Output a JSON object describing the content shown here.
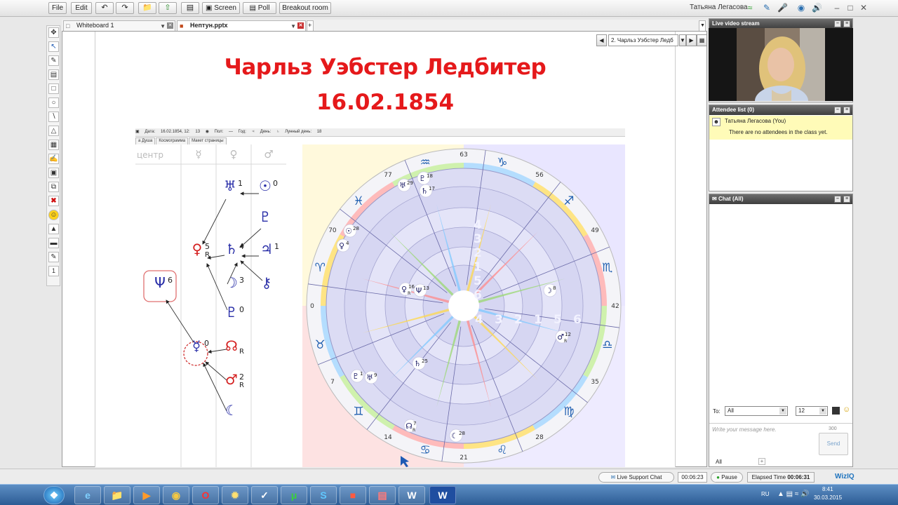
{
  "toolbar": {
    "file": "File",
    "edit": "Edit",
    "screen": "Screen",
    "poll": "Poll",
    "breakout": "Breakout room",
    "user_name": "Татьяна Легасова"
  },
  "tabs": [
    {
      "label": "Whiteboard 1"
    },
    {
      "label": "Нептун.pptx"
    },
    {
      "label": "+"
    }
  ],
  "tools": {
    "page_number": "1"
  },
  "slide": {
    "title": "Чарльз Уэбстер Ледбитер",
    "date": "16.02.1854",
    "selector": "2. Чарльз Уэбстер Ледб"
  },
  "astro_toolbar": {
    "date_label": "Дата:",
    "date_value": "16.02.1854, 12:",
    "date_num": "13",
    "pos_label": "Пол:",
    "pos_value": "—",
    "year_label": "Год:",
    "year_sym": "♃",
    "day_label": "День:",
    "day_sym": "♄",
    "lunar_label": "Лунный день:",
    "lunar_value": "18"
  },
  "astro_tabs": [
    "а Душа",
    "Космограмма",
    "Макет страницы"
  ],
  "diagram": {
    "col_label": "центр",
    "headers": [
      "☿",
      "♀",
      "♂"
    ],
    "nodes": [
      {
        "sym": "♅",
        "num": "1",
        "color": "#2a2fa8"
      },
      {
        "sym": "☉",
        "num": "0",
        "color": "#2a2fa8"
      },
      {
        "sym": "♇",
        "num": "",
        "color": "#2a2fa8"
      },
      {
        "sym": "♀",
        "num": "5",
        "r": "R",
        "color": "#d42020"
      },
      {
        "sym": "♄",
        "num": "4",
        "color": "#2a2fa8"
      },
      {
        "sym": "♃",
        "num": "1",
        "color": "#2a2fa8"
      },
      {
        "sym": "Ψ",
        "num": "6",
        "color": "#2a2fa8"
      },
      {
        "sym": "☽",
        "num": "3",
        "color": "#2a2fa8"
      },
      {
        "sym": "⚷",
        "num": "",
        "color": "#2a2fa8"
      },
      {
        "sym": "♇",
        "num": "0",
        "color": "#2a2fa8"
      },
      {
        "sym": "☿",
        "num": "0",
        "color": "#2a2fa8"
      },
      {
        "sym": "☊",
        "num": "",
        "r": "R",
        "color": "#d42020"
      },
      {
        "sym": "♂",
        "num": "2",
        "r": "R",
        "color": "#d42020"
      },
      {
        "sym": "☾",
        "num": "",
        "color": "#2a2fa8"
      }
    ]
  },
  "wheel": {
    "degree_labels": [
      "63",
      "56",
      "49",
      "42",
      "35",
      "28",
      "21",
      "14",
      "7",
      "0",
      "70",
      "77"
    ],
    "signs": [
      "♑",
      "♐",
      "♏",
      "♎",
      "♍",
      "♌",
      "♋",
      "♊",
      "♉",
      "♈",
      "♓",
      "♒"
    ],
    "planets": [
      {
        "sym": "♅",
        "num": "29"
      },
      {
        "sym": "♇",
        "num": "18"
      },
      {
        "sym": "♄",
        "num": "17"
      },
      {
        "sym": "☉",
        "num": "28"
      },
      {
        "sym": "♀",
        "num": "4"
      },
      {
        "sym": "♀",
        "num": "16",
        "r": "R"
      },
      {
        "sym": "Ψ",
        "num": "13"
      },
      {
        "sym": "☽",
        "num": "8"
      },
      {
        "sym": "♂",
        "num": "12",
        "r": "R"
      },
      {
        "sym": "♄",
        "num": "25"
      },
      {
        "sym": "♇",
        "num": "1"
      },
      {
        "sym": "♅",
        "num": "9"
      },
      {
        "sym": "☊",
        "num": "7",
        "r": "R"
      },
      {
        "sym": "☾",
        "num": "28"
      }
    ],
    "ring_numbers": [
      "4",
      "3",
      "2",
      "1",
      "5",
      "6"
    ]
  },
  "panels": {
    "video_title": "Live video stream",
    "attendee_title": "Attendee list (0)",
    "attendee_you": "Татьяна Легасова (You)",
    "attendee_empty": "There are no attendees in the class yet.",
    "chat_title": "Chat (All)",
    "to_label": "To:",
    "to_value": "All",
    "font_size": "12",
    "message_placeholder": "Write your message here.",
    "char_count": "300",
    "send": "Send",
    "scope": "All"
  },
  "status": {
    "support": "Live Support Chat",
    "timer": "00:06:23",
    "pause": "Pause",
    "elapsed_label": "Elapsed Time",
    "elapsed_value": "00:06:31",
    "brand": "WizIQ"
  },
  "taskbar": {
    "lang": "RU",
    "time": "8:41",
    "date": "30.03.2015",
    "apps": [
      "start-orb",
      "internet-explorer",
      "file-explorer",
      "media-player",
      "chrome",
      "opera",
      "app-burst",
      "app-stylus",
      "utorrent",
      "skype",
      "acrobat",
      "winrar",
      "word-doc",
      "word"
    ]
  }
}
